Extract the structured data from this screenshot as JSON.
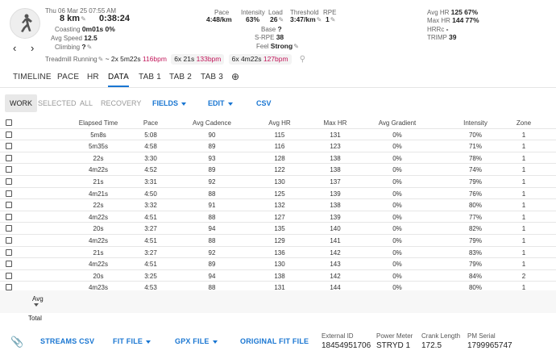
{
  "activity": {
    "date": "Thu 06 Mar 25",
    "time": "07:55 AM",
    "distance": "8 km",
    "duration": "0:38:24",
    "coasting_label": "Coasting",
    "coasting_value": "0m01s",
    "coasting_pct": "0%",
    "avg_speed_label": "Avg Speed",
    "avg_speed": "12.5",
    "climbing_label": "Climbing",
    "climbing_value": "?",
    "type": "Treadmill Running",
    "approx": "~ 2x",
    "intervals": [
      {
        "count": "2x",
        "duration": "5m22s",
        "hr": "116bpm"
      },
      {
        "count": "6x",
        "duration": "21s",
        "hr": "133bpm"
      },
      {
        "count": "6x",
        "duration": "4m22s",
        "hr": "127bpm"
      }
    ]
  },
  "metrics": {
    "pace_label": "Pace",
    "pace": "4:48/km",
    "intensity_label": "Intensity",
    "intensity": "63%",
    "load_label": "Load",
    "load": "26",
    "threshold_label": "Threshold",
    "threshold": "3:47/km",
    "rpe_label": "RPE",
    "rpe": "1",
    "base_label": "Base",
    "base": "?",
    "srpe_label": "S-RPE",
    "srpe": "38",
    "feel_label": "Feel",
    "feel": "Strong"
  },
  "hr": {
    "avg_label": "Avg HR",
    "avg": "125",
    "avg_pct": "67%",
    "max_label": "Max HR",
    "max": "144",
    "max_pct": "77%",
    "hrrc_label": "HRRc",
    "hrrc": "-",
    "trimp_label": "TRIMP",
    "trimp": "39"
  },
  "tabs": [
    "TIMELINE",
    "PACE",
    "HR",
    "DATA",
    "TAB 1",
    "TAB 2",
    "TAB 3"
  ],
  "active_tab": "DATA",
  "toolbar": {
    "work": "WORK",
    "selected": "SELECTED",
    "all": "ALL",
    "recovery": "RECOVERY",
    "fields": "FIELDS",
    "edit": "EDIT",
    "csv": "CSV"
  },
  "table": {
    "columns": [
      "Elapsed Time",
      "Pace",
      "Avg Cadence",
      "Avg HR",
      "Max HR",
      "Avg Gradient",
      "Intensity",
      "Zone"
    ],
    "rows": [
      [
        "5m8s",
        "5:08",
        "90",
        "115",
        "131",
        "0%",
        "70%",
        "1"
      ],
      [
        "5m35s",
        "4:58",
        "89",
        "116",
        "123",
        "0%",
        "71%",
        "1"
      ],
      [
        "22s",
        "3:30",
        "93",
        "128",
        "138",
        "0%",
        "78%",
        "1"
      ],
      [
        "4m22s",
        "4:52",
        "89",
        "122",
        "138",
        "0%",
        "74%",
        "1"
      ],
      [
        "21s",
        "3:31",
        "92",
        "130",
        "137",
        "0%",
        "79%",
        "1"
      ],
      [
        "4m21s",
        "4:50",
        "88",
        "125",
        "139",
        "0%",
        "76%",
        "1"
      ],
      [
        "22s",
        "3:32",
        "91",
        "132",
        "138",
        "0%",
        "80%",
        "1"
      ],
      [
        "4m22s",
        "4:51",
        "88",
        "127",
        "139",
        "0%",
        "77%",
        "1"
      ],
      [
        "20s",
        "3:27",
        "94",
        "135",
        "140",
        "0%",
        "82%",
        "1"
      ],
      [
        "4m22s",
        "4:51",
        "88",
        "129",
        "141",
        "0%",
        "79%",
        "1"
      ],
      [
        "21s",
        "3:27",
        "92",
        "136",
        "142",
        "0%",
        "83%",
        "1"
      ],
      [
        "4m22s",
        "4:51",
        "89",
        "130",
        "143",
        "0%",
        "79%",
        "1"
      ],
      [
        "20s",
        "3:25",
        "94",
        "138",
        "142",
        "0%",
        "84%",
        "2"
      ],
      [
        "4m23s",
        "4:53",
        "88",
        "131",
        "144",
        "0%",
        "80%",
        "1"
      ]
    ],
    "avg_label": "Avg",
    "total_label": "Total"
  },
  "footer": {
    "streams_csv": "STREAMS CSV",
    "fit_file": "FIT FILE",
    "gpx_file": "GPX FILE",
    "original_fit": "ORIGINAL FIT FILE",
    "external_id_label": "External ID",
    "external_id": "18454951706",
    "power_meter_label": "Power Meter",
    "power_meter": "STRYD 1",
    "crank_label": "Crank Length",
    "crank": "172.5",
    "pm_serial_label": "PM Serial",
    "pm_serial": "1799965747"
  },
  "colors": {
    "accent": "#1976d2",
    "interval_hr": "#c2185b"
  }
}
